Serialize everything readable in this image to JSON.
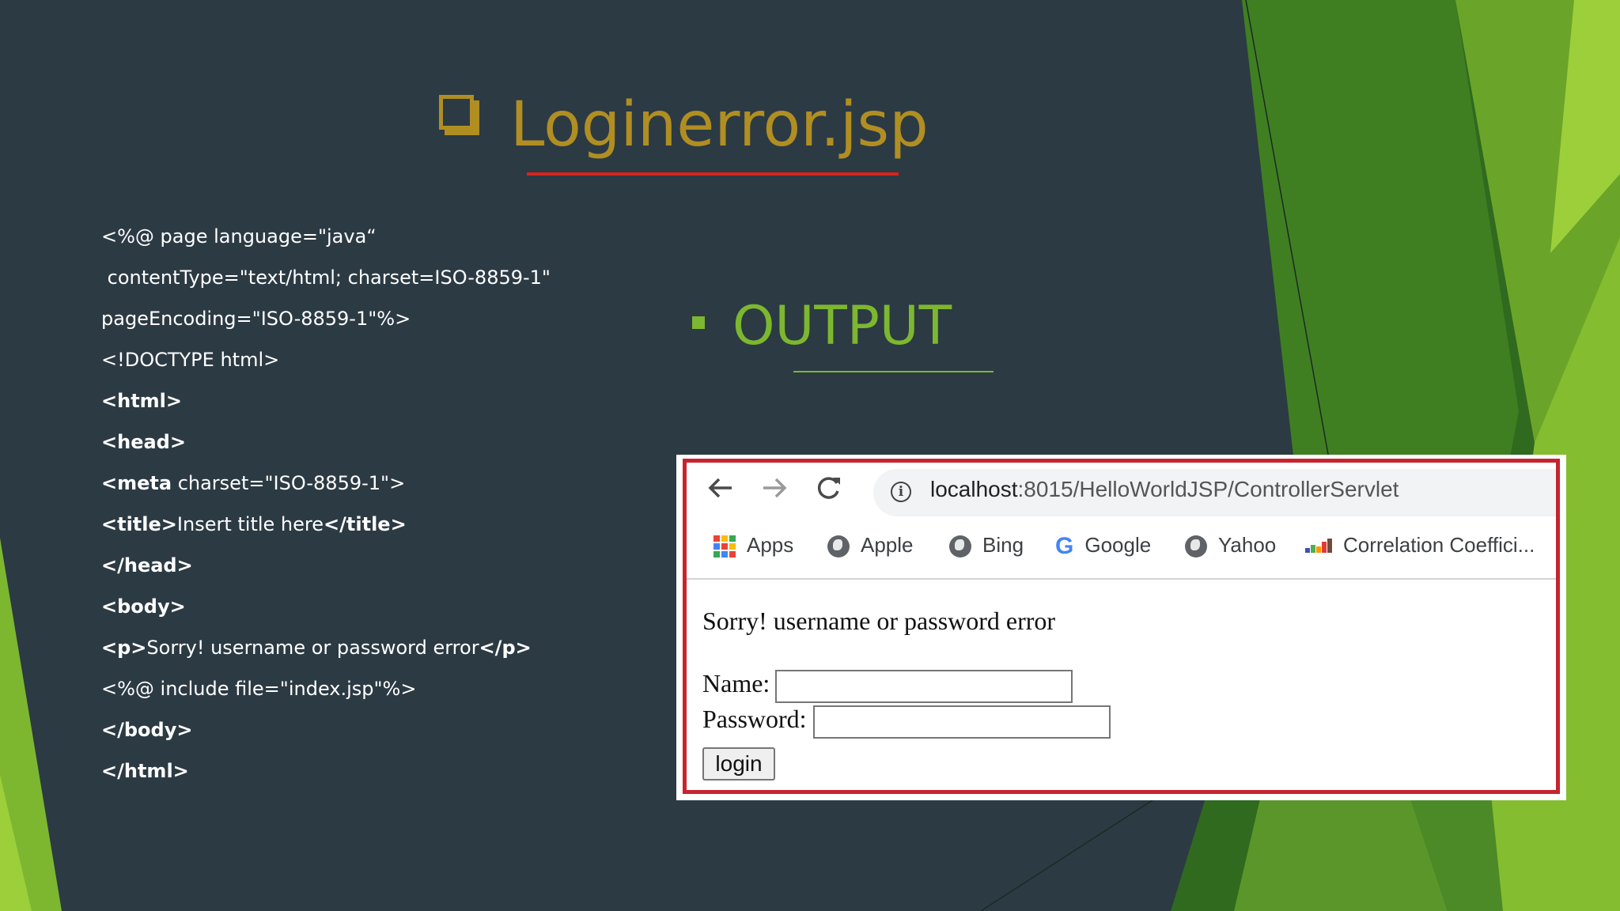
{
  "slide": {
    "title": "Loginerror.jsp",
    "output_heading": "OUTPUT",
    "code_lines": [
      {
        "pre": "",
        "tag": "",
        "post": "<%@ page language=\"java“"
      },
      {
        "pre": "",
        "tag": "",
        "post": " contentType=\"text/html; charset=ISO-8859-1\""
      },
      {
        "pre": "",
        "tag": "",
        "post": "pageEncoding=\"ISO-8859-1\"%>"
      },
      {
        "pre": "",
        "tag": "",
        "post": "<!DOCTYPE html>"
      },
      {
        "pre": "",
        "tag": "<html>",
        "post": ""
      },
      {
        "pre": "",
        "tag": "<head>",
        "post": ""
      },
      {
        "pre": "",
        "tag": "<meta",
        "post": " charset=\"ISO-8859-1\">"
      },
      {
        "pre": "",
        "tag": "<title>",
        "post": "Insert title here",
        "tag2": "</title>"
      },
      {
        "pre": "",
        "tag": "</head>",
        "post": ""
      },
      {
        "pre": "",
        "tag": "<body>",
        "post": ""
      },
      {
        "pre": "",
        "tag": "<p>",
        "post": "Sorry! username or password error",
        "tag2": "</p>"
      },
      {
        "pre": "",
        "tag": "",
        "post": "<%@ include file=\"index.jsp\"%>"
      },
      {
        "pre": "",
        "tag": "</body>",
        "post": ""
      },
      {
        "pre": "",
        "tag": "</html>",
        "post": ""
      }
    ]
  },
  "browser": {
    "back_icon": "back-arrow-icon",
    "forward_icon": "forward-arrow-icon",
    "reload_icon": "reload-icon",
    "url_host": "localhost",
    "url_rest": ":8015/HelloWorldJSP/ControllerServlet",
    "bookmarks": [
      {
        "label": "Apps",
        "icon": "apps-grid-icon"
      },
      {
        "label": "Apple",
        "icon": "globe-icon"
      },
      {
        "label": "Bing",
        "icon": "globe-icon"
      },
      {
        "label": "Google",
        "icon": "google-g-icon"
      },
      {
        "label": "Yahoo",
        "icon": "globe-icon"
      },
      {
        "label": "Correlation Coeffici...",
        "icon": "bar-chart-icon"
      }
    ]
  },
  "page": {
    "message": "Sorry! username or password error",
    "name_label": "Name:",
    "password_label": "Password:",
    "login_button": "login",
    "name_value": "",
    "password_value": ""
  },
  "colors": {
    "background": "#2c3a44",
    "title": "#b08e22",
    "title_underline": "#d8241c",
    "output_green": "#7db72f",
    "frame_border": "#c7242e"
  }
}
